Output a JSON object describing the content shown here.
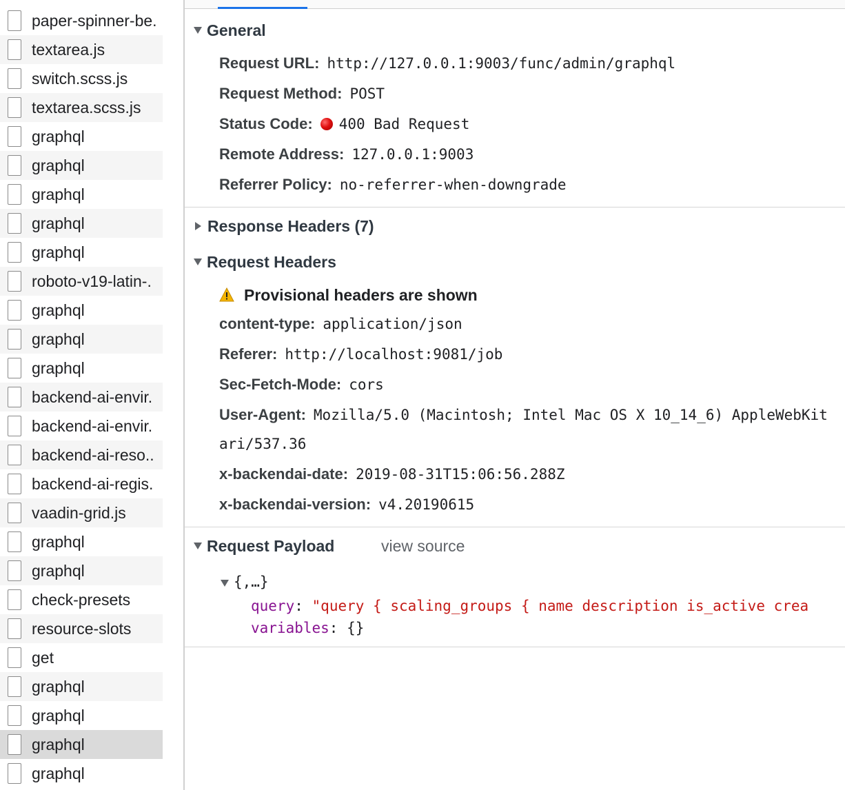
{
  "request_list": [
    {
      "name": "paper-spinner-be."
    },
    {
      "name": "textarea.js"
    },
    {
      "name": "switch.scss.js"
    },
    {
      "name": "textarea.scss.js"
    },
    {
      "name": "graphql"
    },
    {
      "name": "graphql"
    },
    {
      "name": "graphql"
    },
    {
      "name": "graphql"
    },
    {
      "name": "graphql"
    },
    {
      "name": "roboto-v19-latin-."
    },
    {
      "name": "graphql"
    },
    {
      "name": "graphql"
    },
    {
      "name": "graphql"
    },
    {
      "name": "backend-ai-envir."
    },
    {
      "name": "backend-ai-envir."
    },
    {
      "name": "backend-ai-reso.."
    },
    {
      "name": "backend-ai-regis."
    },
    {
      "name": "vaadin-grid.js"
    },
    {
      "name": "graphql"
    },
    {
      "name": "graphql"
    },
    {
      "name": "check-presets"
    },
    {
      "name": "resource-slots"
    },
    {
      "name": "get"
    },
    {
      "name": "graphql"
    },
    {
      "name": "graphql"
    },
    {
      "name": "graphql",
      "selected": true
    },
    {
      "name": "graphql"
    }
  ],
  "general": {
    "title": "General",
    "request_url_label": "Request URL:",
    "request_url": "http://127.0.0.1:9003/func/admin/graphql",
    "request_method_label": "Request Method:",
    "request_method": "POST",
    "status_code_label": "Status Code:",
    "status_code": "400 Bad Request",
    "status_color": "#e01010",
    "remote_address_label": "Remote Address:",
    "remote_address": "127.0.0.1:9003",
    "referrer_policy_label": "Referrer Policy:",
    "referrer_policy": "no-referrer-when-downgrade"
  },
  "response_headers": {
    "title": "Response Headers (7)"
  },
  "request_headers": {
    "title": "Request Headers",
    "warning": "Provisional headers are shown",
    "content_type_label": "content-type:",
    "content_type": "application/json",
    "referer_label": "Referer:",
    "referer": "http://localhost:9081/job",
    "sec_fetch_mode_label": "Sec-Fetch-Mode:",
    "sec_fetch_mode": "cors",
    "user_agent_label": "User-Agent:",
    "user_agent": "Mozilla/5.0 (Macintosh; Intel Mac OS X 10_14_6) AppleWebKit",
    "user_agent_wrap": "ari/537.36",
    "date_label": "x-backendai-date:",
    "date": "2019-08-31T15:06:56.288Z",
    "version_label": "x-backendai-version:",
    "version": "v4.20190615"
  },
  "request_payload": {
    "title": "Request Payload",
    "view_source": "view source",
    "root": "{,…}",
    "query_key": "query",
    "query_value": "\"query {  scaling_groups { name description is_active crea",
    "variables_key": "variables",
    "variables_value": "{}",
    "colon": ":"
  },
  "colors": {
    "accent": "#1a73e8",
    "json_key": "#881391",
    "json_string": "#c41a16"
  }
}
